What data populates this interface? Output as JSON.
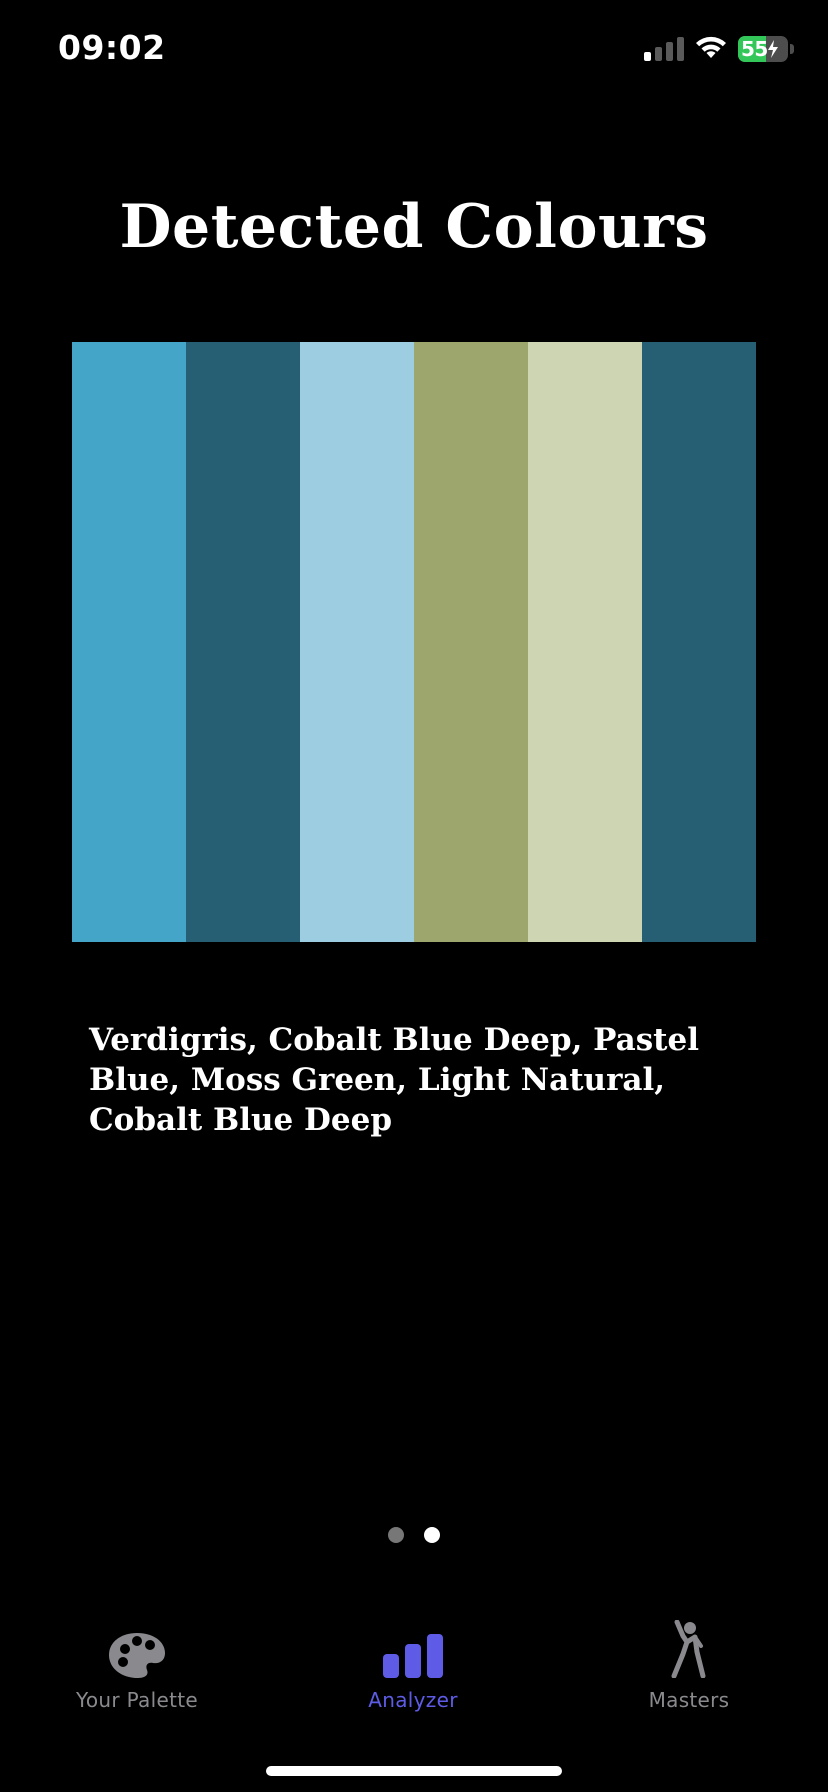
{
  "status_bar": {
    "time": "09:02",
    "battery": "55",
    "battery_level": 0.55,
    "signal_bars_active": 1,
    "icons": [
      "signal-icon",
      "wifi-icon",
      "battery-icon"
    ]
  },
  "title": "Detected Colours",
  "palette": [
    {
      "name": "Verdigris",
      "color": "#44A5C8"
    },
    {
      "name": "Cobalt Blue Deep",
      "color": "#265F74"
    },
    {
      "name": "Pastel Blue",
      "color": "#9DCDE0"
    },
    {
      "name": "Moss Green",
      "color": "#9DA66D"
    },
    {
      "name": "Light Natural",
      "color": "#CED5B3"
    },
    {
      "name": "Cobalt Blue Deep",
      "color": "#265F74"
    }
  ],
  "colour_names_text": "Verdigris, Cobalt Blue Deep, Pastel Blue, Moss Green, Light Natural, Cobalt Blue Deep",
  "pager": {
    "pages": 2,
    "current": 2
  },
  "tabs": [
    {
      "label": "Your Palette",
      "icon": "palette-icon",
      "active": false
    },
    {
      "label": "Analyzer",
      "icon": "bar-chart-icon",
      "active": true
    },
    {
      "label": "Masters",
      "icon": "figure-icon",
      "active": false
    }
  ],
  "colors": {
    "background": "#000000",
    "accent": "#5E5CE6",
    "inactive_tab": "#8A8A8E",
    "battery_green": "#33C759"
  }
}
